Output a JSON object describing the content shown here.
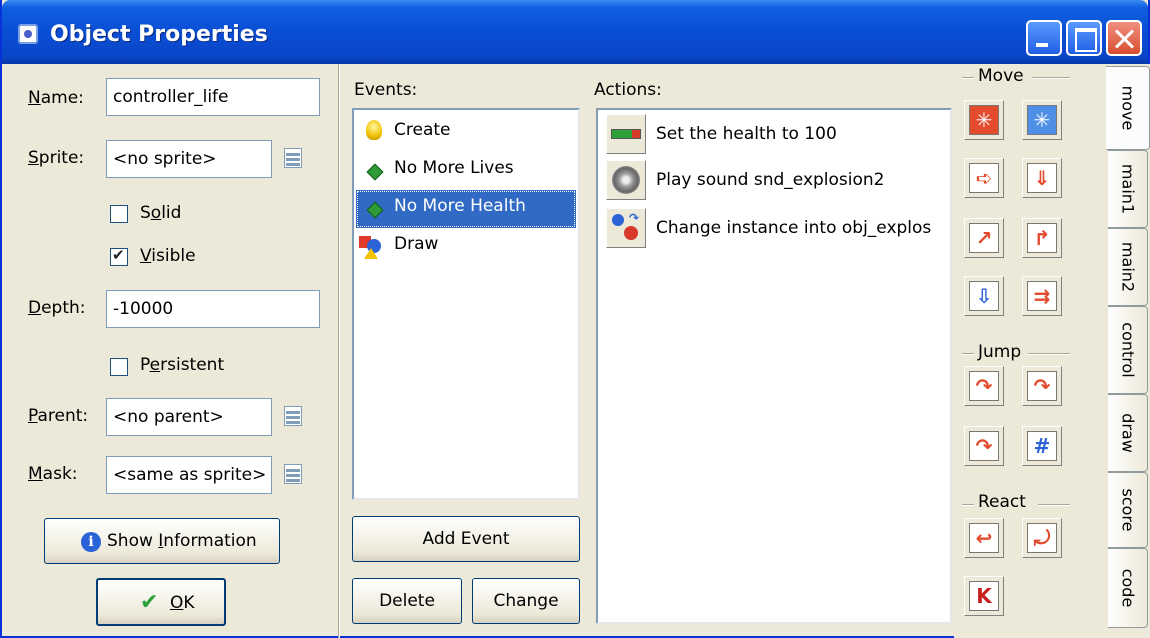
{
  "window": {
    "title": "Object Properties"
  },
  "props": {
    "name_label": "Name:",
    "name_value": "controller_life",
    "sprite_label": "Sprite:",
    "sprite_value": "<no sprite>",
    "solid_label": "Solid",
    "solid_checked": false,
    "visible_label": "Visible",
    "visible_checked": true,
    "depth_label": "Depth:",
    "depth_value": "-10000",
    "persistent_label": "Persistent",
    "persistent_checked": false,
    "parent_label": "Parent:",
    "parent_value": "<no parent>",
    "mask_label": "Mask:",
    "mask_value": "<same as sprite>",
    "show_info_label": "Show Information",
    "ok_label": "OK"
  },
  "events": {
    "label": "Events:",
    "items": [
      {
        "label": "Create",
        "icon": "lightbulb-icon"
      },
      {
        "label": "No More Lives",
        "icon": "green-diamond-icon"
      },
      {
        "label": "No More Health",
        "icon": "green-diamond-icon",
        "selected": true
      },
      {
        "label": "Draw",
        "icon": "draw-shapes-icon"
      }
    ],
    "add_label": "Add Event",
    "delete_label": "Delete",
    "change_label": "Change"
  },
  "actions": {
    "label": "Actions:",
    "items": [
      {
        "label": "Set the health to 100",
        "icon": "health-bar-icon"
      },
      {
        "label": "Play sound snd_explosion2",
        "icon": "speaker-icon"
      },
      {
        "label": "Change instance into obj_explos",
        "icon": "change-instance-icon"
      }
    ]
  },
  "palette": {
    "move_heading": "Move",
    "jump_heading": "Jump",
    "react_heading": "React"
  },
  "tabs": [
    "move",
    "main1",
    "main2",
    "control",
    "draw",
    "score",
    "code"
  ]
}
